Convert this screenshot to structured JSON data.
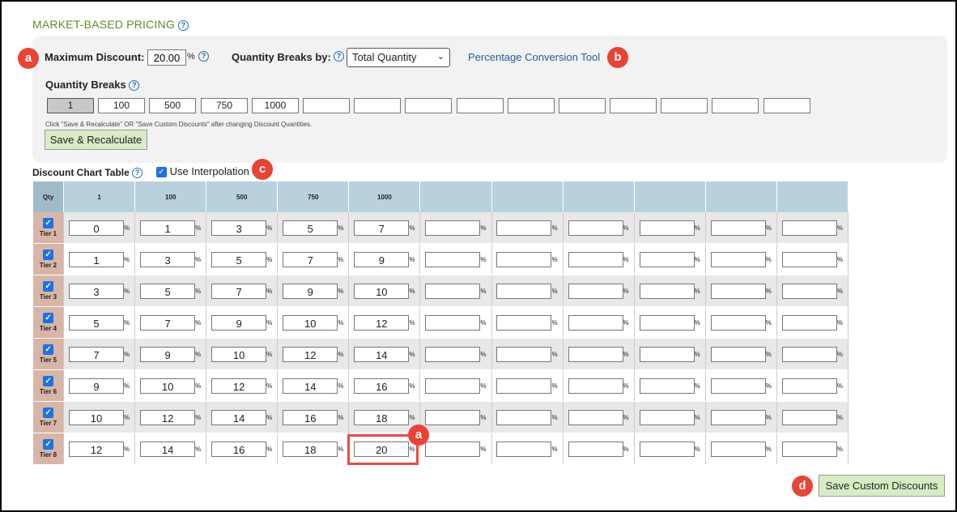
{
  "title": "MARKET-BASED PRICING",
  "max_discount": {
    "label": "Maximum Discount:",
    "value": "20.00",
    "unit": "%"
  },
  "qty_breaks_by": {
    "label": "Quantity Breaks by:",
    "selected": "Total Quantity"
  },
  "conversion_link": "Percentage Conversion Tool",
  "quantity_breaks": {
    "label": "Quantity Breaks",
    "values": [
      "1",
      "100",
      "500",
      "750",
      "1000",
      "",
      "",
      "",
      "",
      "",
      "",
      "",
      "",
      "",
      ""
    ]
  },
  "note": "Click \"Save & Recalculate\" OR \"Save Custom Discounts\" after changing Discount Quantities.",
  "save_recalc_label": "Save & Recalculate",
  "chart": {
    "label": "Discount Chart Table",
    "interpolation_label": "Use Interpolation",
    "qty_header": "Qty",
    "column_headers": [
      "1",
      "100",
      "500",
      "750",
      "1000",
      "",
      "",
      "",
      "",
      "",
      ""
    ],
    "pct_symbol": "%",
    "tiers": [
      {
        "label": "Tier 1",
        "values": [
          "0",
          "1",
          "3",
          "5",
          "7",
          "",
          "",
          "",
          "",
          "",
          ""
        ]
      },
      {
        "label": "Tier 2",
        "values": [
          "1",
          "3",
          "5",
          "7",
          "9",
          "",
          "",
          "",
          "",
          "",
          ""
        ]
      },
      {
        "label": "Tier 3",
        "values": [
          "3",
          "5",
          "7",
          "9",
          "10",
          "",
          "",
          "",
          "",
          "",
          ""
        ]
      },
      {
        "label": "Tier 4",
        "values": [
          "5",
          "7",
          "9",
          "10",
          "12",
          "",
          "",
          "",
          "",
          "",
          ""
        ]
      },
      {
        "label": "Tier 5",
        "values": [
          "7",
          "9",
          "10",
          "12",
          "14",
          "",
          "",
          "",
          "",
          "",
          ""
        ]
      },
      {
        "label": "Tier 6",
        "values": [
          "9",
          "10",
          "12",
          "14",
          "16",
          "",
          "",
          "",
          "",
          "",
          ""
        ]
      },
      {
        "label": "Tier 7",
        "values": [
          "10",
          "12",
          "14",
          "16",
          "18",
          "",
          "",
          "",
          "",
          "",
          ""
        ]
      },
      {
        "label": "Tier 8",
        "values": [
          "12",
          "14",
          "16",
          "18",
          "20",
          "",
          "",
          "",
          "",
          "",
          ""
        ]
      }
    ]
  },
  "save_custom_label": "Save Custom Discounts",
  "badges": {
    "a1": "a",
    "b": "b",
    "c": "c",
    "a2": "a",
    "d": "d"
  },
  "colors": {
    "badge": "#ea4335",
    "title": "#5a8f2e",
    "header": "#b8d1dd",
    "tier": "#d9b5a6",
    "button": "#d8ecc4"
  }
}
